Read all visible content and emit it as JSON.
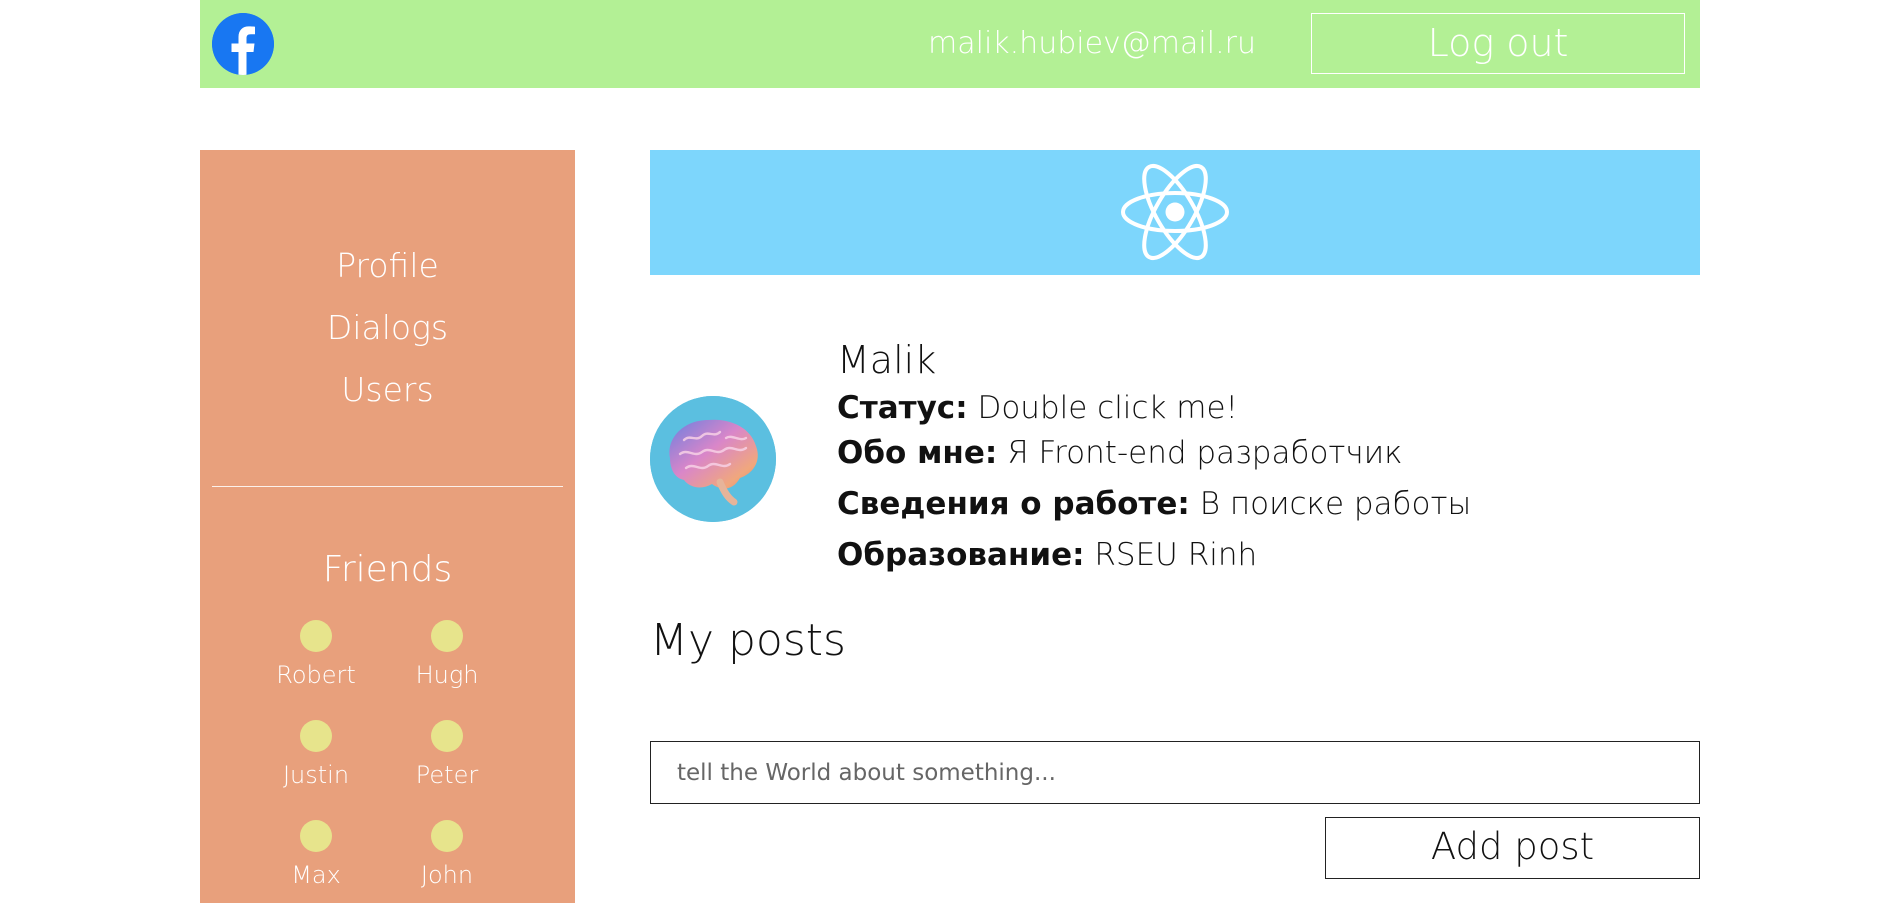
{
  "header": {
    "logo_icon": "facebook-icon",
    "email": "malik.hubiev@mail.ru",
    "logout_label": "Log out",
    "background_color": "#b3f095"
  },
  "sidebar": {
    "background_color": "#e8a07c",
    "nav_items": [
      {
        "label": "Profile"
      },
      {
        "label": "Dialogs"
      },
      {
        "label": "Users"
      }
    ],
    "friends_title": "Friends",
    "friends": [
      {
        "name": "Robert"
      },
      {
        "name": "Hugh"
      },
      {
        "name": "Justin"
      },
      {
        "name": "Peter"
      },
      {
        "name": "Max"
      },
      {
        "name": "John"
      }
    ]
  },
  "main": {
    "banner_icon": "react-icon",
    "banner_color": "#7dd6fc",
    "avatar_icon": "brain-avatar",
    "profile": {
      "name": "Malik",
      "status_label": "Статус:",
      "status_value": "Double click me!",
      "about_label": "Обо мне:",
      "about_value": "Я Front-end разработчик",
      "job_label": "Сведения о работе:",
      "job_value": "В поиске работы",
      "education_label": "Образование:",
      "education_value": "RSEU Rinh"
    },
    "posts": {
      "title": "My posts",
      "input_placeholder": "tell the World about something...",
      "add_button_label": "Add post"
    }
  }
}
